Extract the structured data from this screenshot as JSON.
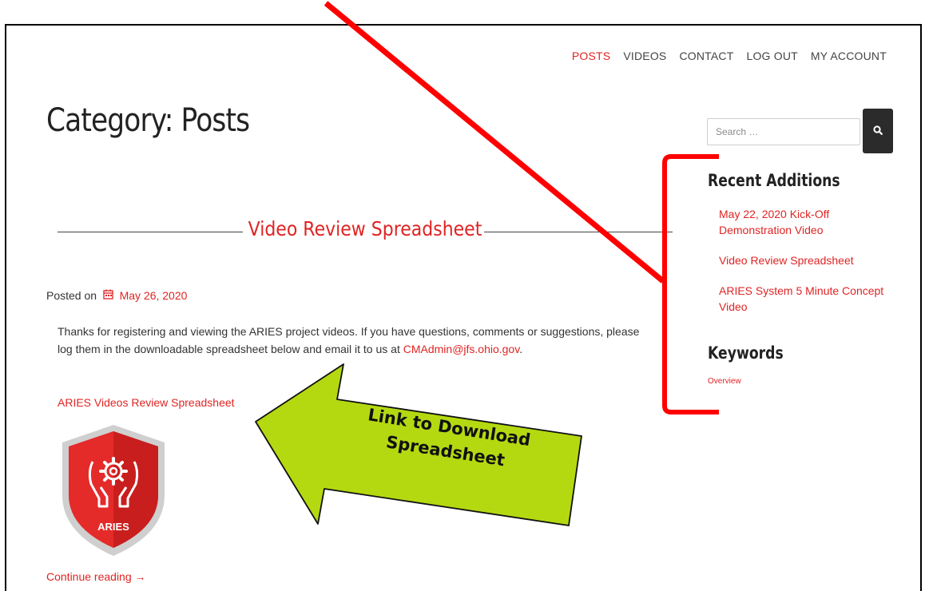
{
  "nav": {
    "items": [
      {
        "label": "POSTS",
        "active": true
      },
      {
        "label": "VIDEOS",
        "active": false
      },
      {
        "label": "CONTACT",
        "active": false
      },
      {
        "label": "LOG OUT",
        "active": false
      },
      {
        "label": "MY ACCOUNT",
        "active": false
      }
    ]
  },
  "page": {
    "title": "Category: Posts"
  },
  "post": {
    "title": "Video Review Spreadsheet",
    "posted_on_label": "Posted on",
    "date": "May 26, 2020",
    "body_line1": "Thanks for registering and viewing the ARIES project videos.  If you have questions, comments or suggestions, please",
    "body_line2_prefix": "log them in the downloadable spreadsheet below and email it to us at ",
    "email": "CMAdmin@jfs.ohio.gov",
    "body_line2_suffix": ".",
    "download_link": "ARIES Videos Review Spreadsheet",
    "logo_text": "ARIES",
    "continue_label": "Continue reading →"
  },
  "sidebar": {
    "search_placeholder": "Search …",
    "recent_heading": "Recent Additions",
    "recent_items": [
      "May 22, 2020 Kick-Off Demonstration Video",
      "Video Review Spreadsheet",
      "ARIES System 5 Minute Concept Video"
    ],
    "keywords_heading": "Keywords",
    "keywords": [
      "Overview"
    ]
  },
  "annotation": {
    "arrow_text_line1": "Link to Download",
    "arrow_text_line2": "Spreadsheet"
  },
  "colors": {
    "accent": "#e02424",
    "annotation_red": "#ff0000",
    "arrow_green": "#b5d911"
  }
}
